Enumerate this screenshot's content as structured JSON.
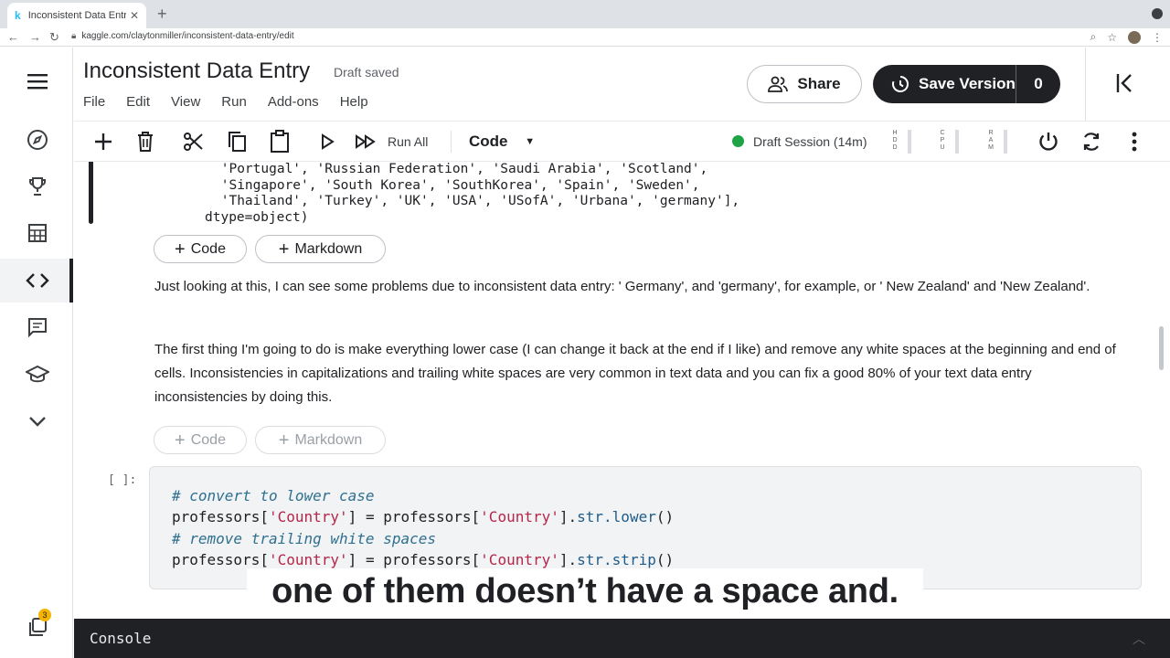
{
  "browser": {
    "tab_title": "Inconsistent Data Entry | Kaggle",
    "tab_favicon": "k",
    "url": "kaggle.com/claytonmiller/inconsistent-data-entry/edit"
  },
  "notebook": {
    "title": "Inconsistent Data Entry",
    "save_status": "Draft saved",
    "menu": [
      "File",
      "Edit",
      "View",
      "Run",
      "Add-ons",
      "Help"
    ],
    "share_label": "Share",
    "save_version_label": "Save Version",
    "save_version_count": "0"
  },
  "toolbar": {
    "run_all_label": "Run All",
    "cell_type": "Code",
    "session_label": "Draft Session (14m)",
    "session_color": "#1ea446",
    "meters": [
      "HDD",
      "CPU",
      "RAM"
    ]
  },
  "cells": {
    "output_lines": [
      " 'Portugal', 'Russian Federation', 'Saudi Arabia', 'Scotland',",
      " 'Singapore', 'South Korea', 'SouthKorea', 'Spain', 'Sweden',",
      " 'Thailand', 'Turkey', 'UK', 'USA', 'USofA', 'Urbana', 'germany'],",
      "dtype=object)"
    ],
    "add_code_label": "Code",
    "add_markdown_label": "Markdown",
    "markdown_1": "Just looking at this, I can see some problems due to inconsistent data entry: ' Germany', and 'germany', for example, or ' New Zealand' and 'New Zealand'.",
    "markdown_2": "The first thing I'm going to do is make everything lower case (I can change it back at the end if I like) and remove any white spaces at the beginning and end of cells. Inconsistencies in capitalizations and trailing white spaces are very common in text data and you can fix a good 80% of your text data entry inconsistencies by doing this.",
    "code_prompt": "[ ]:",
    "code": {
      "comment_1": "# convert to lower case",
      "comment_2": "# remove trailing white spaces",
      "var": "professors",
      "key": "'Country'",
      "method_1": "str.lower",
      "method_2": "str.strip"
    }
  },
  "caption": "one of them doesn’t have a space and.",
  "console_label": "Console",
  "notification_count": "3"
}
